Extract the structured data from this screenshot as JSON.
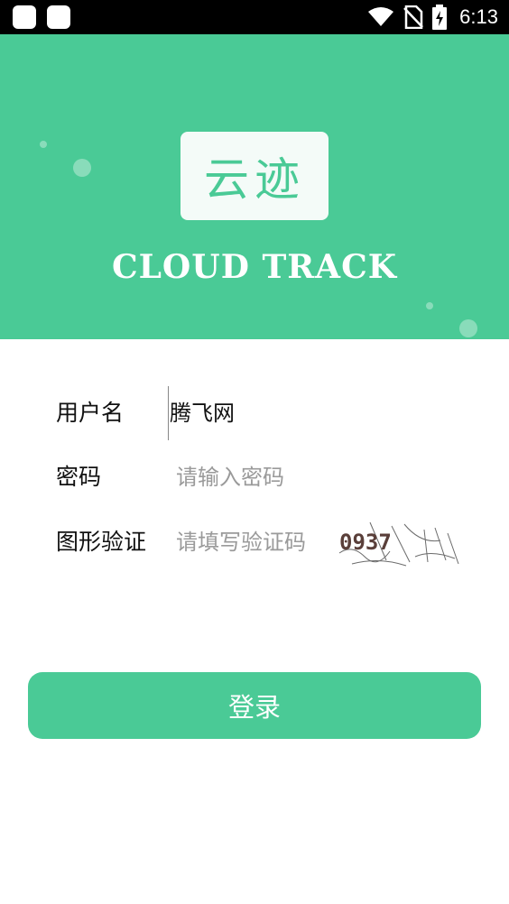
{
  "status_bar": {
    "time": "6:13",
    "icons": [
      "app-notification-icon",
      "app-notification-icon",
      "wifi-icon",
      "no-sim-icon",
      "battery-charging-icon"
    ]
  },
  "header": {
    "logo_text": "云迹",
    "brand_text": "CLOUD TRACK"
  },
  "form": {
    "username": {
      "label": "用户名",
      "value": "腾飞网"
    },
    "password": {
      "label": "密码",
      "placeholder": "请输入密码"
    },
    "captcha": {
      "label": "图形验证",
      "placeholder": "请填写验证码",
      "image_text": "0937"
    }
  },
  "login_button": {
    "label": "登录"
  },
  "colors": {
    "accent": "#4aca96",
    "background": "#ffffff",
    "statusbar": "#000000"
  }
}
